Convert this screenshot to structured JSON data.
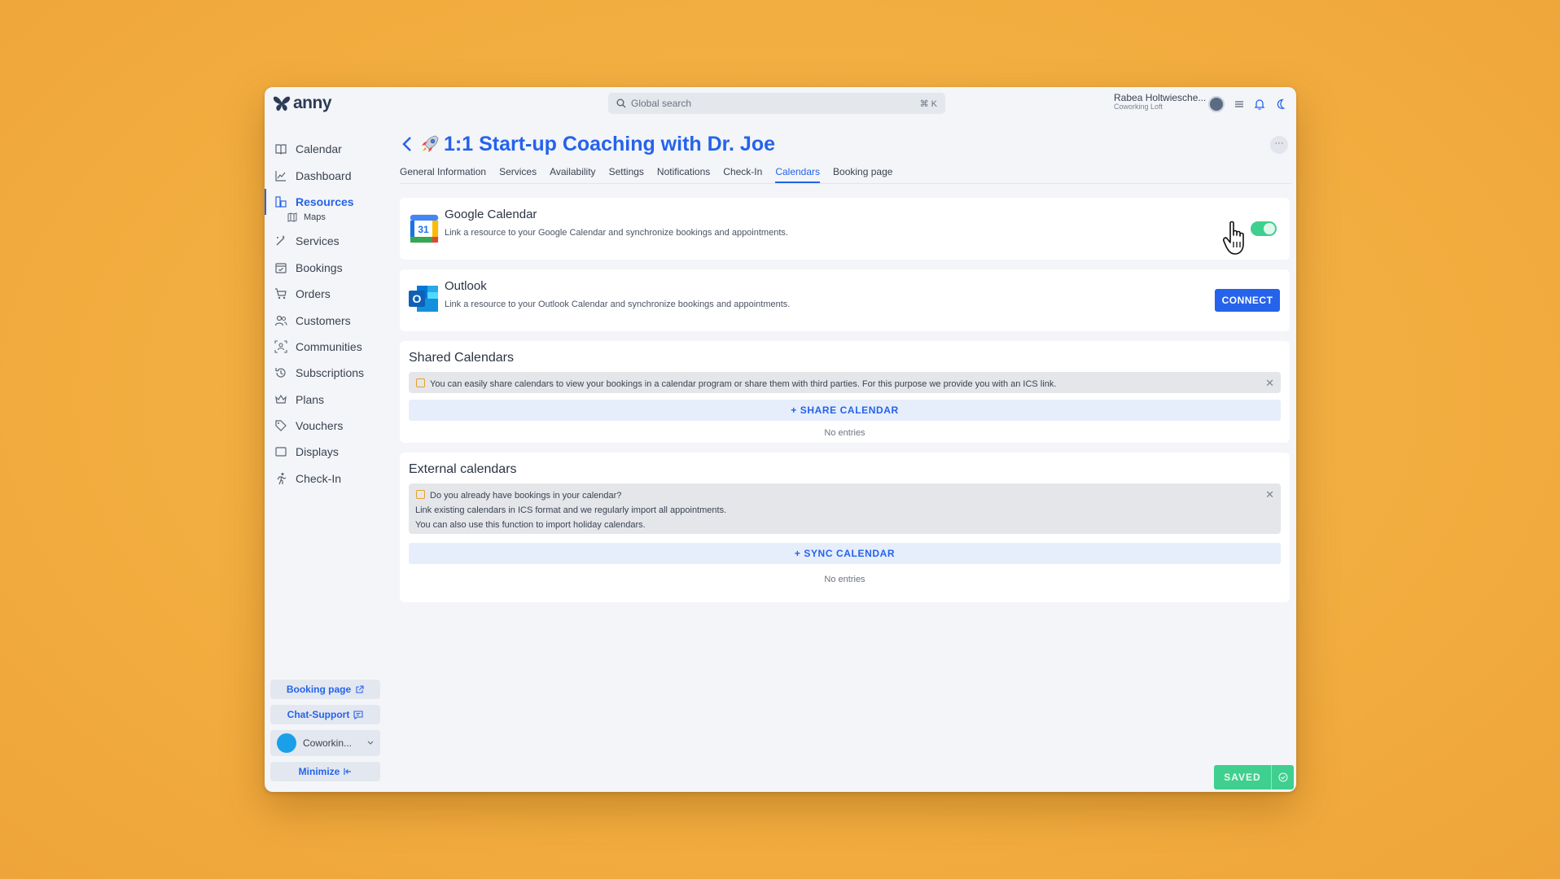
{
  "app": {
    "logo_text": "anny"
  },
  "search": {
    "placeholder": "Global search",
    "shortcut": "⌘ K"
  },
  "user": {
    "name": "Rabea Holtwiesche...",
    "org": "Coworking Loft"
  },
  "sidebar": {
    "items": [
      {
        "label": "Calendar",
        "icon": "book-icon"
      },
      {
        "label": "Dashboard",
        "icon": "chart-icon"
      },
      {
        "label": "Resources",
        "icon": "resources-icon",
        "active": true
      },
      {
        "label": "Services",
        "icon": "wand-icon"
      },
      {
        "label": "Bookings",
        "icon": "calendar-check-icon"
      },
      {
        "label": "Orders",
        "icon": "cart-icon"
      },
      {
        "label": "Customers",
        "icon": "users-icon"
      },
      {
        "label": "Communities",
        "icon": "community-icon"
      },
      {
        "label": "Subscriptions",
        "icon": "history-icon"
      },
      {
        "label": "Plans",
        "icon": "crown-icon"
      },
      {
        "label": "Vouchers",
        "icon": "tag-icon"
      },
      {
        "label": "Displays",
        "icon": "display-icon"
      },
      {
        "label": "Check-In",
        "icon": "run-icon"
      }
    ],
    "sub_item": {
      "label": "Maps",
      "icon": "map-icon"
    },
    "booking_page": "Booking page",
    "chat_support": "Chat-Support",
    "org_switch": "Coworkin...",
    "minimize": "Minimize"
  },
  "page": {
    "back_icon": "chevron-left-icon",
    "title": "1:1 Start-up Coaching with Dr. Joe",
    "more": "···",
    "tabs": [
      {
        "label": "General Information"
      },
      {
        "label": "Services"
      },
      {
        "label": "Availability"
      },
      {
        "label": "Settings"
      },
      {
        "label": "Notifications"
      },
      {
        "label": "Check-In"
      },
      {
        "label": "Calendars",
        "active": true
      },
      {
        "label": "Booking page"
      }
    ]
  },
  "google": {
    "title": "Google Calendar",
    "desc": "Link a resource to your Google Calendar and synchronize bookings and appointments.",
    "enabled": true,
    "logo_day": "31"
  },
  "outlook": {
    "title": "Outlook",
    "desc": "Link a resource to your Outlook Calendar and synchronize bookings and appointments.",
    "button": "CONNECT",
    "logo_letter": "O"
  },
  "shared": {
    "title": "Shared Calendars",
    "info": "You can easily share calendars to view your bookings in a calendar program or share them with third parties. For this purpose we provide you with an ICS link.",
    "button": "+ SHARE CALENDAR",
    "empty": "No entries"
  },
  "external": {
    "title": "External calendars",
    "info_lines": [
      "Do you already have bookings in your calendar?",
      "Link existing calendars in ICS format and we regularly import all appointments.",
      "You can also use this function to import holiday calendars."
    ],
    "button": "+ SYNC CALENDAR",
    "empty": "No entries"
  },
  "status": {
    "saved": "SAVED"
  },
  "colors": {
    "accent": "#2563eb",
    "success": "#3fcf8e",
    "background": "#f2ad3f"
  }
}
